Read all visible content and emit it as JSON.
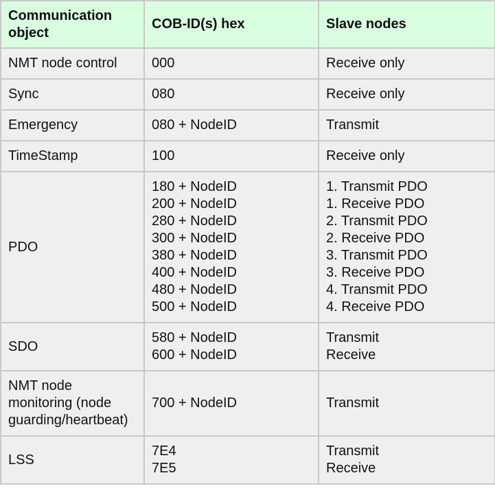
{
  "headers": [
    "Communication object",
    "COB-ID(s) hex",
    "Slave nodes"
  ],
  "rows": [
    {
      "object": [
        "NMT node control"
      ],
      "cobid": [
        "000"
      ],
      "slave": [
        "Receive only"
      ]
    },
    {
      "object": [
        "Sync"
      ],
      "cobid": [
        "080"
      ],
      "slave": [
        "Receive only"
      ]
    },
    {
      "object": [
        "Emergency"
      ],
      "cobid": [
        "080 + NodeID"
      ],
      "slave": [
        "Transmit"
      ]
    },
    {
      "object": [
        "TimeStamp"
      ],
      "cobid": [
        "100"
      ],
      "slave": [
        "Receive only"
      ]
    },
    {
      "object": [
        "PDO"
      ],
      "cobid": [
        "180 + NodeID",
        "200 + NodeID",
        "280 + NodeID",
        "300 + NodeID",
        "380 + NodeID",
        "400 + NodeID",
        "480 + NodeID",
        "500 + NodeID"
      ],
      "slave": [
        "1. Transmit PDO",
        "1. Receive PDO",
        "2. Transmit PDO",
        "2. Receive PDO",
        "3. Transmit PDO",
        "3. Receive PDO",
        "4. Transmit PDO",
        "4. Receive PDO"
      ]
    },
    {
      "object": [
        "SDO"
      ],
      "cobid": [
        "580 + NodeID",
        "600 + NodeID"
      ],
      "slave": [
        "Transmit",
        "Receive"
      ]
    },
    {
      "object": [
        "NMT node",
        "monitoring (node",
        "guarding/heartbeat)"
      ],
      "cobid": [
        "700 + NodeID"
      ],
      "slave": [
        "Transmit"
      ]
    },
    {
      "object": [
        "LSS"
      ],
      "cobid": [
        "7E4",
        "7E5"
      ],
      "slave": [
        "Transmit",
        "Receive"
      ]
    }
  ]
}
